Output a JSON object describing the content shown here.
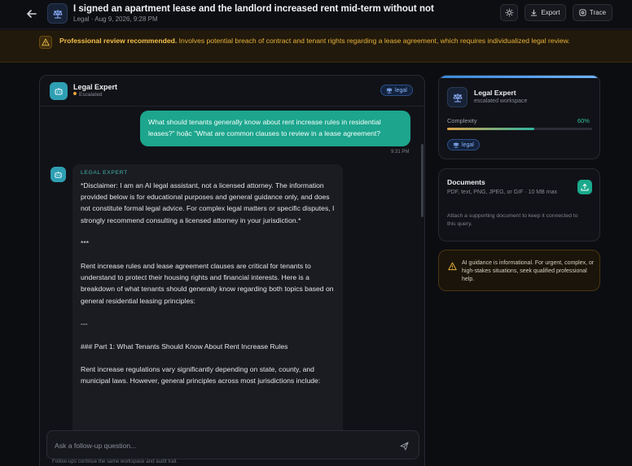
{
  "header": {
    "title": "I signed an apartment lease and the landlord increased rent mid-term without not",
    "meta": "Legal · Aug 9, 2026, 9:28 PM",
    "export_label": "Export",
    "trace_label": "Trace"
  },
  "banner": {
    "strong": "Professional review recommended.",
    "text": " Involves potential breach of contract and tenant rights regarding a lease agreement, which requires individualized legal review."
  },
  "chat": {
    "agent_name": "Legal Expert",
    "agent_status": "Escalated",
    "tag": "legal",
    "user_message": "What should tenants generally know about rent increase rules in residential leases?\" hoặc \"What are common clauses to review in a lease agreement?",
    "user_time": "9:31 PM",
    "bot_label": "LEGAL EXPERT",
    "bot_paragraphs": [
      "*Disclaimer: I am an AI legal assistant, not a licensed attorney. The information provided below is for educational purposes and general guidance only, and does not constitute formal legal advice. For complex legal matters or specific disputes, I strongly recommend consulting a licensed attorney in your jurisdiction.*",
      "***",
      "Rent increase rules and lease agreement clauses are critical for tenants to understand to protect their housing rights and financial interests. Here is a breakdown of what tenants should generally know regarding both topics based on general residential leasing principles:",
      "---",
      "### Part 1: What Tenants Should Know About Rent Increase Rules",
      "Rent increase regulations vary significantly depending on state, county, and municipal laws. However, general principles across most jurisdictions include:"
    ],
    "composer_placeholder": "Ask a follow-up question...",
    "composer_hint": "Follow-ups continue the same workspace and audit trail."
  },
  "agent_card": {
    "name": "Legal Expert",
    "subtitle": "escalated workspace",
    "complexity_label": "Complexity",
    "complexity_value": "60%",
    "complexity_fraction": 0.6,
    "tag": "legal"
  },
  "documents": {
    "title": "Documents",
    "formats": "PDF, text, PNG, JPEG, or GIF · 10 MB max",
    "hint": "Attach a supporting document to keep it connected to this query."
  },
  "notice": {
    "text": "AI guidance is informational. For urgent, complex, or high-stakes situations, seek qualified professional help."
  },
  "colors": {
    "accent_teal": "#1da58d",
    "warning": "#e8b13a",
    "chip_blue": "#8db5ff"
  }
}
